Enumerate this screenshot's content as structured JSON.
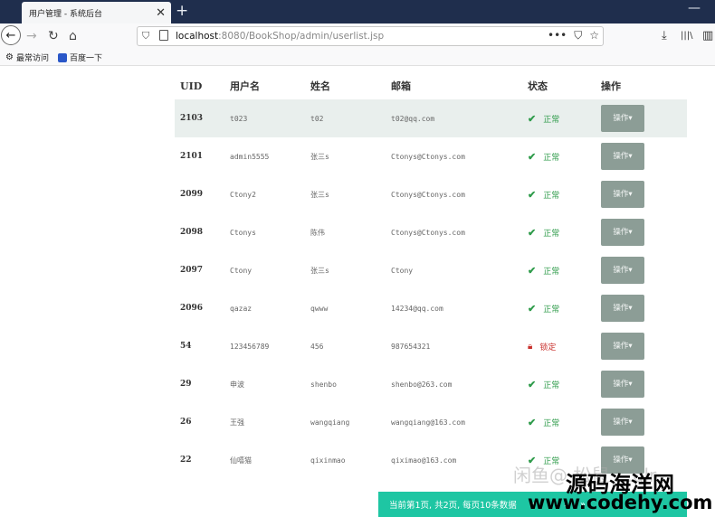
{
  "browser": {
    "tab_title": "用户管理 - 系统后台",
    "tab_close": "✕",
    "new_tab": "+",
    "window_minimize": "—",
    "url_host": "localhost",
    "url_rest": ":8080/BookShop/admin/userlist.jsp",
    "url_actions": {
      "more": "•••",
      "pocket": "⛉",
      "star": "☆"
    },
    "toolbar": {
      "download": "⤓",
      "library": "|||\\",
      "sidebar": "▥"
    },
    "bookmarks": [
      {
        "icon": "gear-icon",
        "label": "最常访问"
      },
      {
        "icon": "baidu-paw-icon",
        "label": "百度一下"
      }
    ]
  },
  "table": {
    "headers": [
      "UID",
      "用户名",
      "姓名",
      "邮箱",
      "状态",
      "操作"
    ],
    "rows": [
      {
        "uid": "2103",
        "username": "t023",
        "name": "t02",
        "email": "t02@qq.com",
        "status": "正常",
        "status_type": "normal",
        "action": "操作▾"
      },
      {
        "uid": "2101",
        "username": "admin5555",
        "name": "张三s",
        "email": "Ctonys@Ctonys.com",
        "status": "正常",
        "status_type": "normal",
        "action": "操作▾"
      },
      {
        "uid": "2099",
        "username": "Ctony2",
        "name": "张三s",
        "email": "Ctonys@Ctonys.com",
        "status": "正常",
        "status_type": "normal",
        "action": "操作▾"
      },
      {
        "uid": "2098",
        "username": "Ctonys",
        "name": "陈伟",
        "email": "Ctonys@Ctonys.com",
        "status": "正常",
        "status_type": "normal",
        "action": "操作▾"
      },
      {
        "uid": "2097",
        "username": "Ctony",
        "name": "张三s",
        "email": "Ctony",
        "status": "正常",
        "status_type": "normal",
        "action": "操作▾"
      },
      {
        "uid": "2096",
        "username": "qazaz",
        "name": "qwww",
        "email": "14234@qq.com",
        "status": "正常",
        "status_type": "normal",
        "action": "操作▾"
      },
      {
        "uid": "54",
        "username": "123456789",
        "name": "456",
        "email": "987654321",
        "status": "锁定",
        "status_type": "locked",
        "action": "操作▾"
      },
      {
        "uid": "29",
        "username": "申波",
        "name": "shenbo",
        "email": "shenbo@263.com",
        "status": "正常",
        "status_type": "normal",
        "action": "操作▾"
      },
      {
        "uid": "26",
        "username": "王强",
        "name": "wangqiang",
        "email": "wangqiang@163.com",
        "status": "正常",
        "status_type": "normal",
        "action": "操作▾"
      },
      {
        "uid": "22",
        "username": "仙嘻猫",
        "name": "qixinmao",
        "email": "qiximao@163.com",
        "status": "正常",
        "status_type": "normal",
        "action": "操作▾"
      }
    ]
  },
  "pagination": {
    "summary": "当前第1页, 共2页, 每页10条数据",
    "buttons": [
      "«",
      "‹",
      "›",
      "»"
    ]
  },
  "watermarks": {
    "faded": "闲鱼@ 松鼠 ...ulr",
    "site_name": "源码海洋网",
    "site_url": "www.codehy.com"
  },
  "colors": {
    "accent": "#1ec6a3",
    "ok": "#2e9b4a",
    "locked": "#c9302c",
    "action_button": "#8c9d96",
    "highlight_row": "#e9efed"
  }
}
